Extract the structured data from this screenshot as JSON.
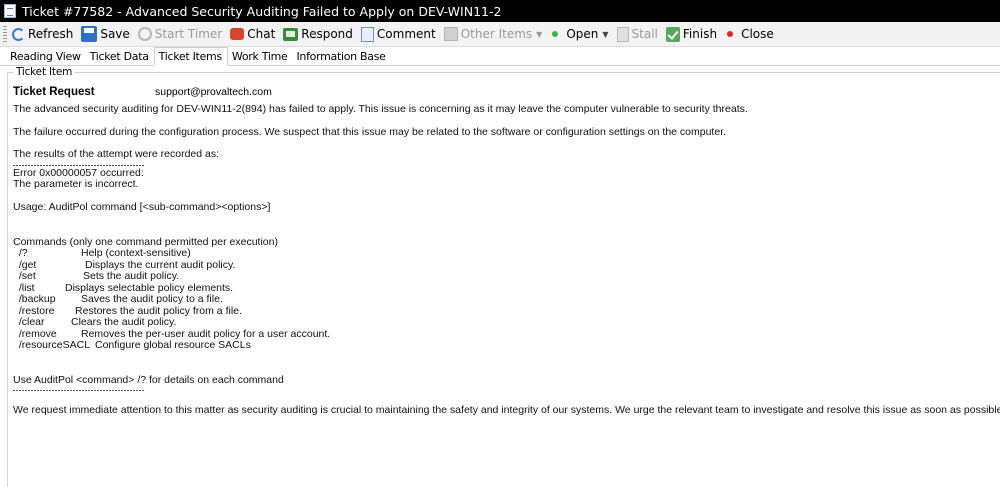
{
  "window": {
    "title": "Ticket #77582 - Advanced Security Auditing Failed to Apply on DEV-WIN11-2"
  },
  "toolbar": {
    "refresh": "Refresh",
    "save": "Save",
    "start_timer": "Start Timer",
    "chat": "Chat",
    "respond": "Respond",
    "comment": "Comment",
    "other_items": "Other Items",
    "open": "Open",
    "stall": "Stall",
    "finish": "Finish",
    "close": "Close"
  },
  "tabs": [
    "Reading View",
    "Ticket Data",
    "Ticket Items",
    "Work Time",
    "Information Base"
  ],
  "group_label": "Ticket Item",
  "request": {
    "heading": "Ticket Request",
    "email": "support@provaltech.com"
  },
  "body": {
    "p1": "The advanced security auditing for DEV-WIN11-2(894) has failed to apply. This issue is concerning as it may leave the computer vulnerable to security threats.",
    "p2": "The failure occurred during the configuration process. We suspect that this issue may be related to the software or configuration settings on the computer.",
    "p3": "The results of the attempt were recorded as:",
    "error1": "Error 0x00000057 occurred:",
    "error2": "The parameter is incorrect.",
    "usage": "Usage: AuditPol command [<sub-command><options>]",
    "commands_title": "Commands (only one command permitted per execution)",
    "commands": [
      {
        "cmd": "  /?",
        "desc": "Help (context-sensitive)"
      },
      {
        "cmd": "  /get",
        "desc": "Displays the current audit policy."
      },
      {
        "cmd": "  /set",
        "desc": "Sets the audit policy."
      },
      {
        "cmd": "  /list",
        "desc": "Displays selectable policy elements."
      },
      {
        "cmd": "  /backup",
        "desc": "Saves the audit policy to a file."
      },
      {
        "cmd": "  /restore",
        "desc": "Restores the audit policy from a file."
      },
      {
        "cmd": "  /clear",
        "desc": "Clears the audit policy."
      },
      {
        "cmd": "  /remove",
        "desc": "Removes the per-user audit policy for a user account."
      },
      {
        "cmd": "  /resourceSACL",
        "desc": "Configure global resource SACLs"
      }
    ],
    "use_hint": "Use AuditPol <command> /? for details on each command",
    "p_final": "We request immediate attention to this matter as security auditing is crucial to maintaining the safety and integrity of our systems. We urge the relevant team to investigate and resolve this issue as soon as possible."
  }
}
